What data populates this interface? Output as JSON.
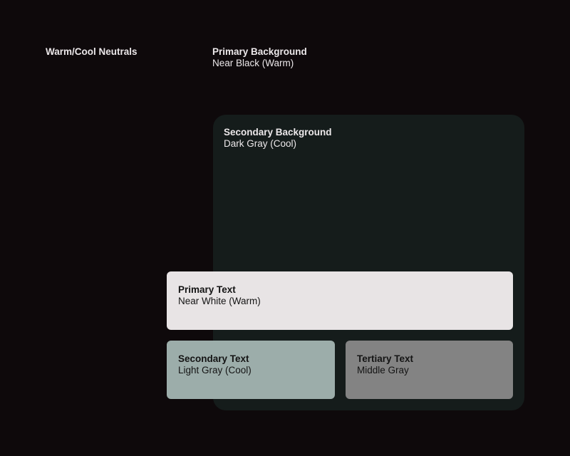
{
  "title": "Warm/Cool Neutrals",
  "colors": {
    "primary_background": "#0e090b",
    "secondary_background": "#151c1b",
    "primary_text": "#e8e4e5",
    "secondary_text": "#9cadaa",
    "tertiary_text": "#838383"
  },
  "swatches": {
    "primary_background": {
      "title": "Primary Background",
      "subtitle": "Near Black (Warm)"
    },
    "secondary_background": {
      "title": "Secondary Background",
      "subtitle": "Dark Gray (Cool)"
    },
    "primary_text": {
      "title": "Primary Text",
      "subtitle": "Near White (Warm)"
    },
    "secondary_text": {
      "title": "Secondary Text",
      "subtitle": "Light Gray (Cool)"
    },
    "tertiary_text": {
      "title": "Tertiary Text",
      "subtitle": "Middle Gray"
    }
  }
}
